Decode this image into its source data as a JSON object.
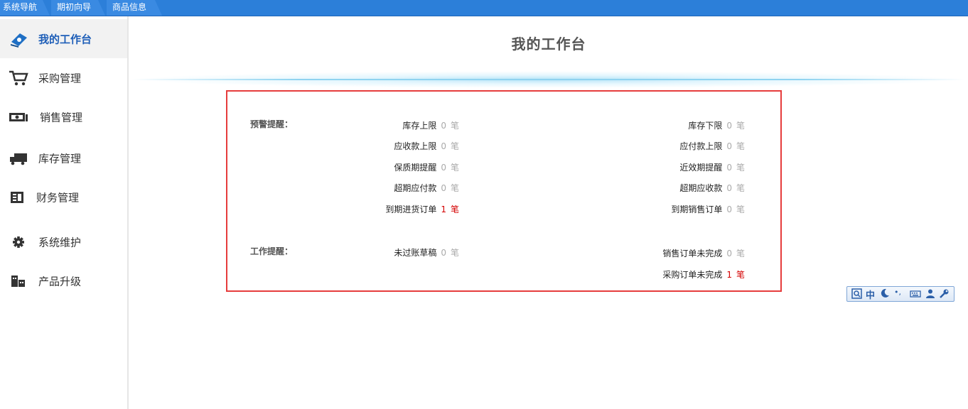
{
  "topbar": {
    "tabs": [
      "系统导航",
      "期初向导",
      "商品信息"
    ]
  },
  "sidebar": {
    "items": [
      {
        "label": "我的工作台",
        "icon": "workbench-icon",
        "active": true
      },
      {
        "label": "采购管理",
        "icon": "cart-icon"
      },
      {
        "label": "销售管理",
        "icon": "cash-icon"
      },
      {
        "label": "库存管理",
        "icon": "truck-icon"
      },
      {
        "label": "财务管理",
        "icon": "ledger-icon"
      },
      {
        "label": "系统维护",
        "icon": "gear-icon"
      },
      {
        "label": "产品升级",
        "icon": "building-icon"
      }
    ]
  },
  "main": {
    "title": "我的工作台",
    "warning": {
      "label": "预警提醒：",
      "left": [
        {
          "name": "库存上限",
          "count": "0",
          "unit": "笔"
        },
        {
          "name": "应收款上限",
          "count": "0",
          "unit": "笔"
        },
        {
          "name": "保质期提醒",
          "count": "0",
          "unit": "笔"
        },
        {
          "name": "超期应付款",
          "count": "0",
          "unit": "笔"
        },
        {
          "name": "到期进货订单",
          "count": "1",
          "unit": "笔",
          "alert": true
        }
      ],
      "right": [
        {
          "name": "库存下限",
          "count": "0",
          "unit": "笔"
        },
        {
          "name": "应付款上限",
          "count": "0",
          "unit": "笔"
        },
        {
          "name": "近效期提醒",
          "count": "0",
          "unit": "笔"
        },
        {
          "name": "超期应收款",
          "count": "0",
          "unit": "笔"
        },
        {
          "name": "到期销售订单",
          "count": "0",
          "unit": "笔"
        }
      ]
    },
    "work": {
      "label": "工作提醒：",
      "left": [
        {
          "name": "未过账草稿",
          "count": "0",
          "unit": "笔"
        }
      ],
      "right": [
        {
          "name": "销售订单未完成",
          "count": "0",
          "unit": "笔"
        },
        {
          "name": "采购订单未完成",
          "count": "1",
          "unit": "笔",
          "alert": true
        }
      ]
    }
  },
  "ime": {
    "items": [
      "中",
      "•,"
    ]
  },
  "colors": {
    "topbar": "#2c7fd9",
    "active_nav": "#1f5fb8",
    "panel_border": "#e63c3c",
    "alert": "#d40000"
  }
}
